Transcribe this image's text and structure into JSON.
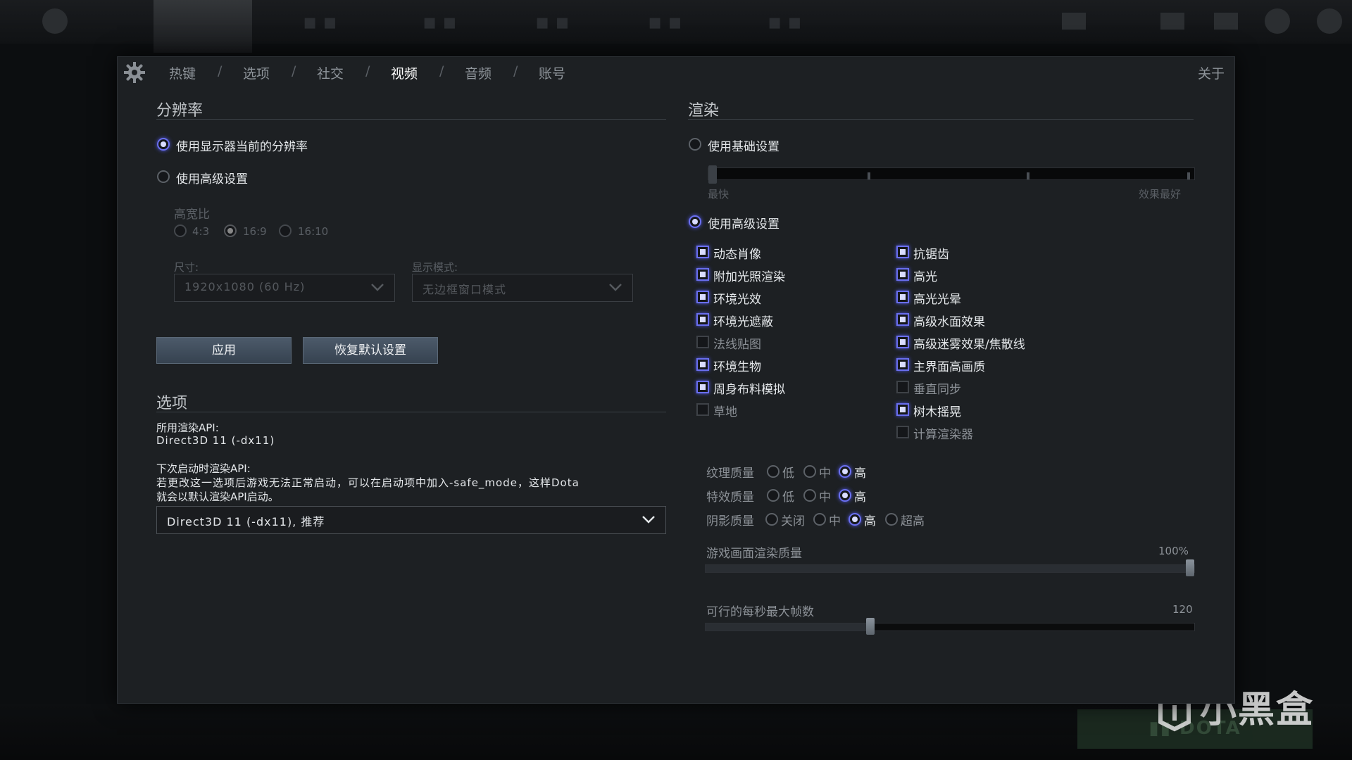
{
  "tabs": {
    "hotkeys": "热键",
    "options": "选项",
    "social": "社交",
    "video": "视频",
    "audio": "音频",
    "account": "账号",
    "separator": "/",
    "about": "关于"
  },
  "resolution": {
    "title": "分辨率",
    "use_current": "使用显示器当前的分辨率",
    "use_advanced": "使用高级设置",
    "aspect_label": "高宽比",
    "aspect_43": "4:3",
    "aspect_169": "16:9",
    "aspect_1610": "16:10",
    "size_label": "尺寸:",
    "size_value": "1920x1080 (60 Hz)",
    "display_mode_label": "显示模式:",
    "display_mode_value": "无边框窗口模式",
    "apply": "应用",
    "restore_defaults": "恢复默认设置"
  },
  "options": {
    "title": "选项",
    "render_api_label": "所用渲染API:",
    "render_api_value": "Direct3D 11 (-dx11)",
    "next_api_label": "下次启动时渲染API:",
    "next_api_note_1": "若更改这一选项后游戏无法正常启动，可以在启动项中加入-safe_mode，这样Dota",
    "next_api_note_2": "就会以默认渲染API启动。",
    "api_select_value": "Direct3D 11 (-dx11), 推荐"
  },
  "rendering": {
    "title": "渲染",
    "use_basic": "使用基础设置",
    "slider_min_label": "最快",
    "slider_max_label": "效果最好",
    "use_advanced": "使用高级设置",
    "checks_left": [
      {
        "label": "动态肖像",
        "on": true
      },
      {
        "label": "附加光照渲染",
        "on": true
      },
      {
        "label": "环境光效",
        "on": true
      },
      {
        "label": "环境光遮蔽",
        "on": true
      },
      {
        "label": "法线贴图",
        "on": false
      },
      {
        "label": "环境生物",
        "on": true
      },
      {
        "label": "周身布料模拟",
        "on": true
      },
      {
        "label": "草地",
        "on": false
      }
    ],
    "checks_right": [
      {
        "label": "抗锯齿",
        "on": true
      },
      {
        "label": "高光",
        "on": true
      },
      {
        "label": "高光光晕",
        "on": true
      },
      {
        "label": "高级水面效果",
        "on": true
      },
      {
        "label": "高级迷雾效果/焦散线",
        "on": true
      },
      {
        "label": "主界面高画质",
        "on": true
      },
      {
        "label": "垂直同步",
        "on": false
      },
      {
        "label": "树木摇晃",
        "on": true
      },
      {
        "label": "计算渲染器",
        "on": false
      }
    ],
    "texture_label": "纹理质量",
    "effects_label": "特效质量",
    "shadow_label": "阴影质量",
    "q_low": "低",
    "q_mid": "中",
    "q_high": "高",
    "q_off": "关闭",
    "q_ultra": "超高",
    "render_quality_label": "游戏画面渲染质量",
    "render_quality_value": "100%",
    "render_quality_fraction": 1.0,
    "fps_label": "可行的每秒最大帧数",
    "fps_value": "120",
    "fps_fraction": 0.335
  },
  "watermark": "小黑盒",
  "colors": {
    "accent": "#6a6ff0",
    "panel_bg": "#1d2023",
    "button": "#455261"
  }
}
